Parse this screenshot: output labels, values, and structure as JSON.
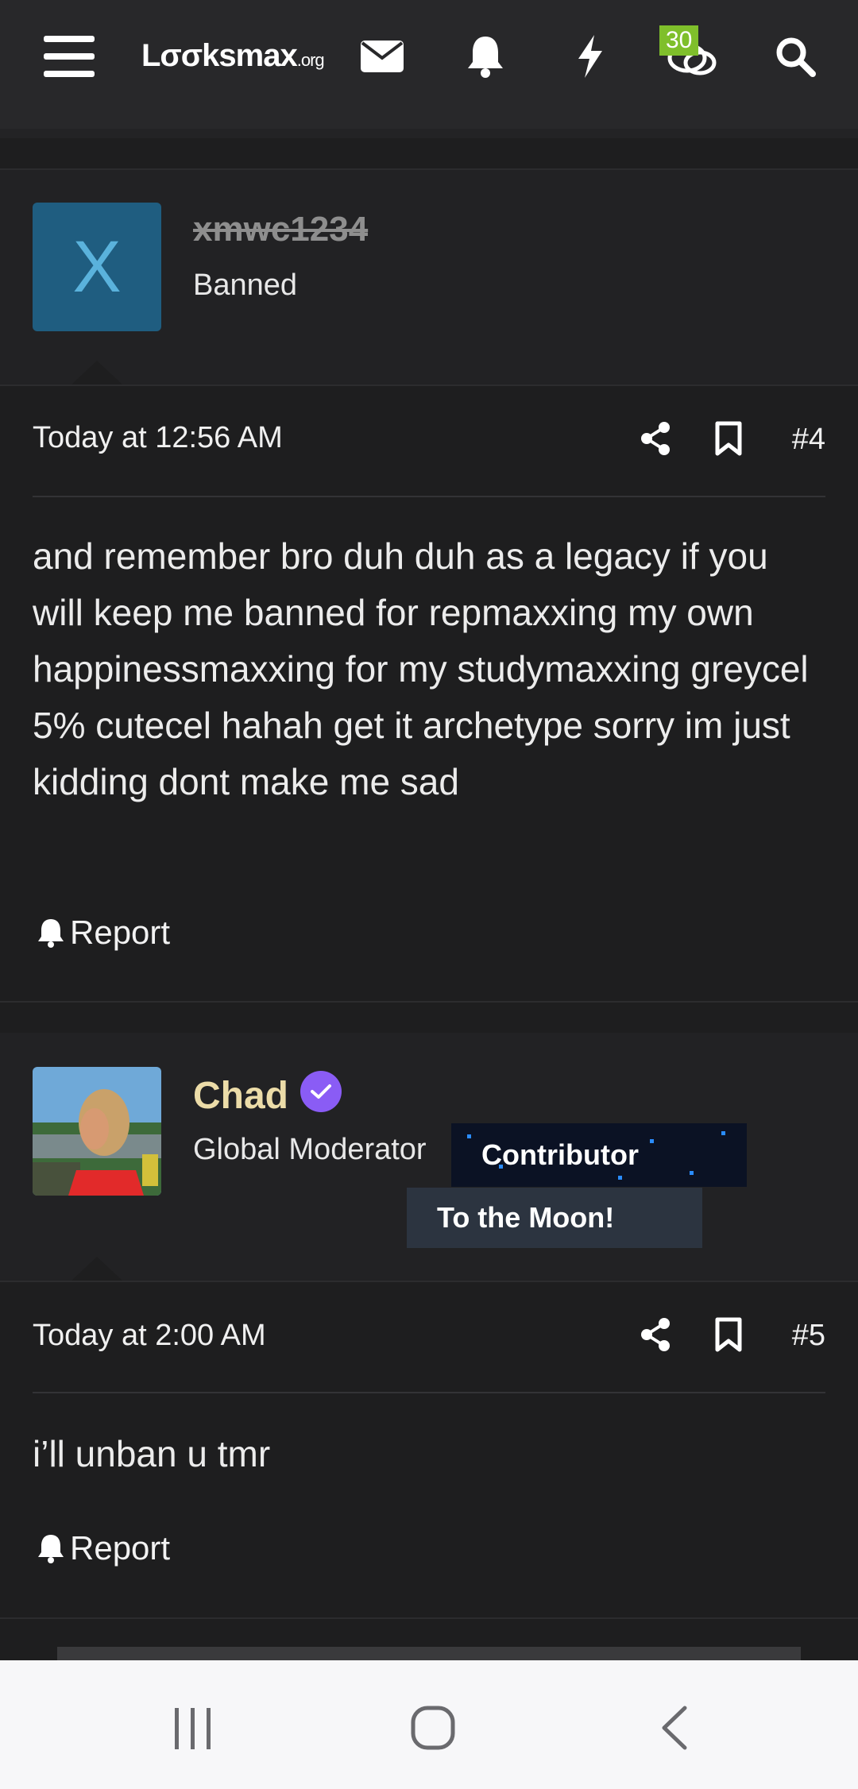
{
  "header": {
    "logo_main": "Lσσksmax",
    "logo_suffix": ".org",
    "chat_badge": "30",
    "icons": [
      "menu-icon",
      "envelope-icon",
      "bell-icon",
      "lightning-icon",
      "chat-bubbles-icon",
      "search-icon"
    ]
  },
  "posts": [
    {
      "avatar_letter": "X",
      "username": "xmwc1234",
      "user_title": "Banned",
      "timestamp": "Today at 12:56 AM",
      "post_number": "#4",
      "body": "and remember bro duh duh as a legacy if you will keep me banned for repmaxxing my own happinessmaxxing for my studymaxxing greycel 5% cutecel hahah get it archetype sorry im just kidding dont make me sad",
      "report_label": "Report"
    },
    {
      "username": "Chad",
      "user_title": "Global Moderator",
      "banners": [
        "Contributor",
        "To the Moon!"
      ],
      "timestamp": "Today at 2:00 AM",
      "post_number": "#5",
      "body": "i’ll unban u tmr",
      "report_label": "Report"
    }
  ],
  "colors": {
    "background": "#1e1e1f",
    "banned_avatar": "#1f5d80",
    "moderator_name": "#ecdca8",
    "verified": "#8a5cf5",
    "badge": "#7fbf2b"
  }
}
